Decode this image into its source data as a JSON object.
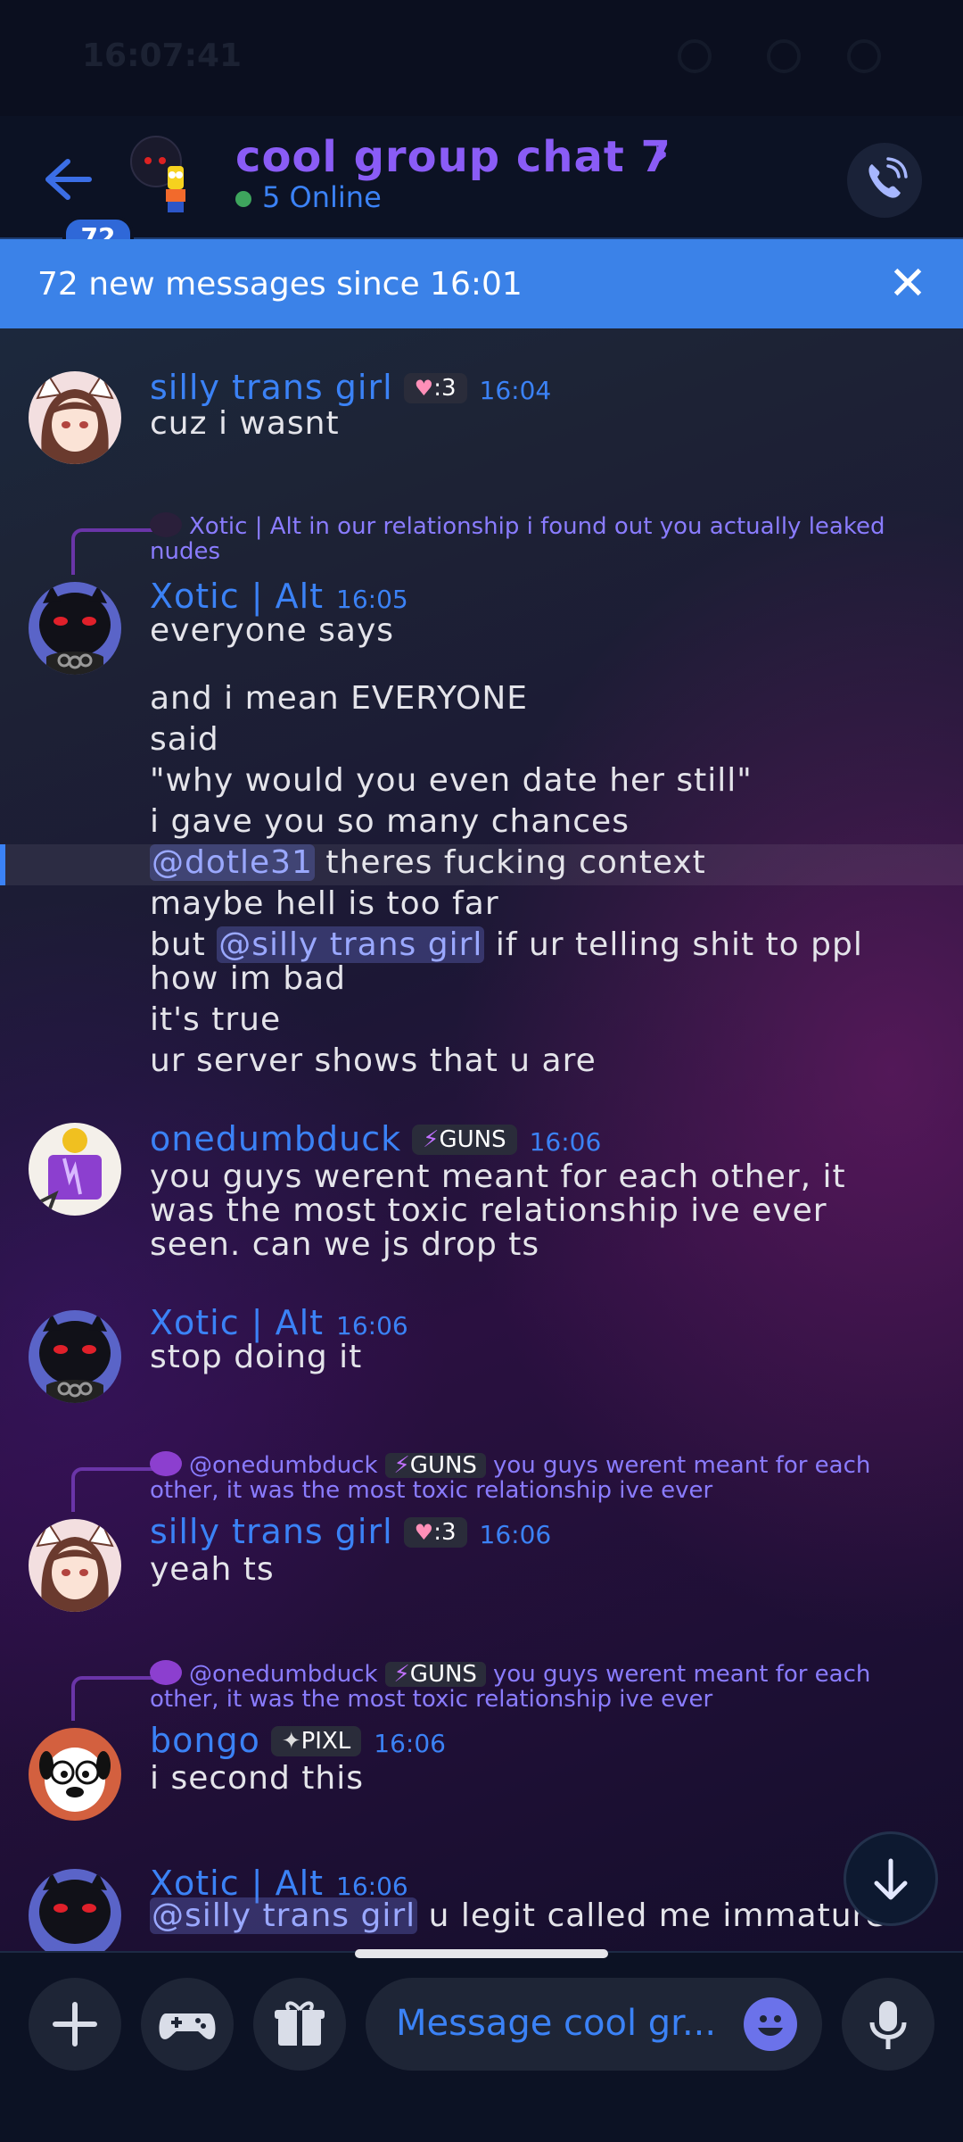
{
  "status_bar": {
    "time": "16:07:41"
  },
  "header": {
    "unread_count": "72",
    "title": "cool group chat 7",
    "chevron": "›",
    "online": "5 Online"
  },
  "new_messages_bar": {
    "text": "72 new messages since 16:01",
    "close": "✕"
  },
  "messages": [
    {
      "author": "silly trans girl",
      "tag": ":3",
      "time": "16:04",
      "lines": [
        "cuz i wasnt"
      ]
    },
    {
      "reply": {
        "author": "Xotic | Alt",
        "text": "in our relationship i found out you actually leaked nudes"
      },
      "author": "Xotic | Alt",
      "time": "16:05",
      "lines": [
        "everyone says",
        "and i mean EVERYONE",
        "said",
        "\"why would you even date her still\"",
        "i gave you so many chances"
      ],
      "mention1": "@dotle31",
      "line6_rest": "theres fucking context",
      "line7": "maybe hell is too far",
      "line8_pre": "but",
      "mention2": "@silly trans girl",
      "line8_rest": "if ur telling shit to ppl",
      "line9": "how im bad",
      "line10": "it's true",
      "line11": "ur server shows that u are"
    },
    {
      "author": "onedumbduck",
      "tag": "GUNS",
      "time": "16:06",
      "lines": [
        "you guys werent meant for each other, it",
        "was the most toxic relationship ive ever",
        "seen. can we js drop ts"
      ]
    },
    {
      "author": "Xotic | Alt",
      "time": "16:06",
      "lines": [
        "stop doing it"
      ]
    },
    {
      "reply": {
        "author": "@onedumbduck",
        "tag": "GUNS",
        "text": "you guys werent meant for each other, it was the most toxic relationship ive ever"
      },
      "author": "silly trans girl",
      "tag": ":3",
      "time": "16:06",
      "lines": [
        "yeah ts"
      ]
    },
    {
      "reply": {
        "author": "@onedumbduck",
        "tag": "GUNS",
        "text": "you guys werent meant for each other, it was the most toxic relationship ive ever"
      },
      "author": "bongo",
      "tag": "PIXL",
      "time": "16:06",
      "lines": [
        "i second this"
      ]
    },
    {
      "author": "Xotic | Alt",
      "time": "16:06",
      "mention": "@silly trans girl",
      "rest": "u legit called me immature"
    }
  ],
  "composer": {
    "placeholder": "Message cool gr..."
  },
  "icons": {
    "back": "arrow-left-icon",
    "call": "phone-icon",
    "close": "close-icon",
    "scroll": "arrow-down-icon",
    "add": "plus-icon",
    "games": "gamepad-icon",
    "gift": "gift-icon",
    "emoji": "emoji-icon",
    "mic": "microphone-icon"
  },
  "colors": {
    "accent": "#3b82f6",
    "title": "#8a5cf6",
    "banner": "#3b82e8",
    "online": "#3ea55d"
  }
}
